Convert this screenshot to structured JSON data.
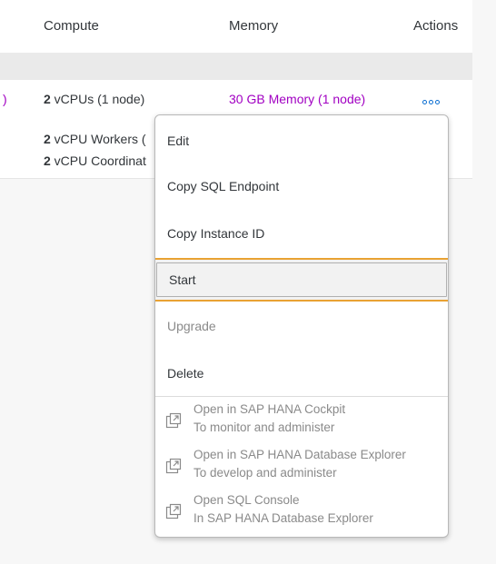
{
  "table": {
    "headers": {
      "compute": "Compute",
      "memory": "Memory",
      "actions": "Actions"
    },
    "rows": [
      {
        "partial_prefix": ")",
        "compute_bold": "2",
        "compute_rest": " vCPUs (1 node)",
        "memory": "30 GB Memory (1 node)"
      },
      {
        "line1_bold": "2",
        "line1_rest": " vCPU Workers (",
        "line2_bold": "2",
        "line2_rest": " vCPU Coordinat"
      }
    ]
  },
  "menu": {
    "items": [
      {
        "label": "Edit"
      },
      {
        "label": "Copy SQL Endpoint"
      },
      {
        "label": "Copy Instance ID"
      },
      {
        "label": "Start"
      },
      {
        "label": "Upgrade"
      },
      {
        "label": "Delete"
      }
    ],
    "links": [
      {
        "title": "Open in SAP HANA Cockpit",
        "subtitle": "To monitor and administer",
        "icon": "external-link-icon"
      },
      {
        "title": "Open in SAP HANA Database Explorer",
        "subtitle": "To develop and administer",
        "icon": "external-link-icon"
      },
      {
        "title": "Open SQL Console",
        "subtitle": "In SAP HANA Database Explorer",
        "icon": "external-link-icon"
      }
    ]
  },
  "colors": {
    "accent_blue": "#0a6ed1",
    "memory_magenta": "#a100c2",
    "highlight_orange": "#e9a233"
  }
}
